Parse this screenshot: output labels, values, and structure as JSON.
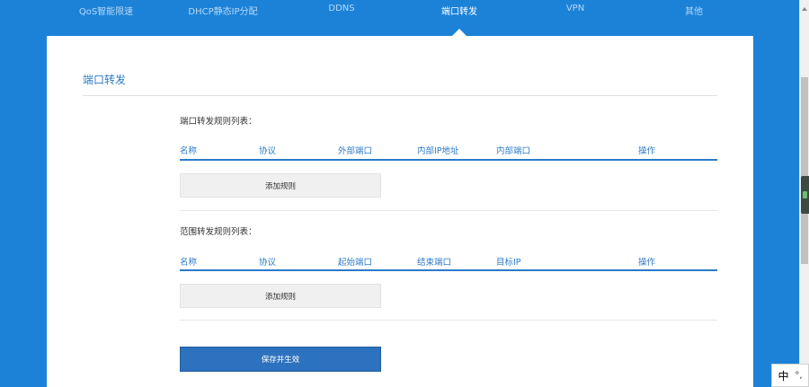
{
  "nav": {
    "items": [
      {
        "label": "QoS智能限速",
        "active": false
      },
      {
        "label": "DHCP静态IP分配",
        "active": false
      },
      {
        "label": "DDNS",
        "active": false
      },
      {
        "label": "端口转发",
        "active": true
      },
      {
        "label": "VPN",
        "active": false
      },
      {
        "label": "其他",
        "active": false
      }
    ]
  },
  "page": {
    "title": "端口转发"
  },
  "port_forward": {
    "heading": "端口转发规则列表：",
    "columns": [
      "名称",
      "协议",
      "外部端口",
      "内部IP地址",
      "内部端口",
      "操作"
    ],
    "add_label": "添加规则"
  },
  "range_forward": {
    "heading": "范围转发规则列表：",
    "columns": [
      "名称",
      "协议",
      "起始端口",
      "结束端口",
      "目标IP",
      "操作"
    ],
    "add_label": "添加规则"
  },
  "save_label": "保存并生效",
  "ime": {
    "mode": "中",
    "punct": "°,"
  },
  "colors": {
    "brand_blue": "#1b82d8",
    "link_blue": "#2c7bc8",
    "button_blue": "#2d72bf"
  }
}
